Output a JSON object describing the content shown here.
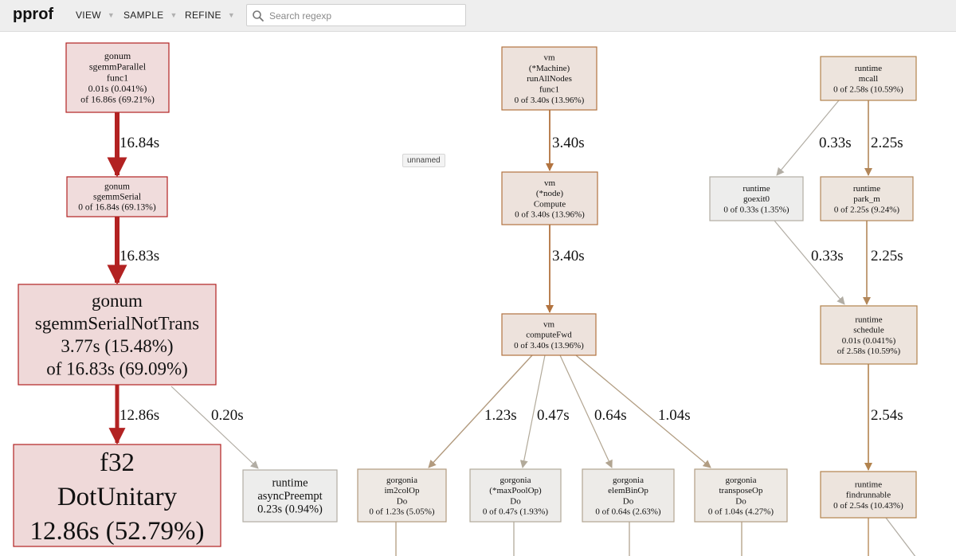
{
  "app": {
    "title": "pprof"
  },
  "menus": [
    {
      "label": "VIEW"
    },
    {
      "label": "SAMPLE"
    },
    {
      "label": "REFINE"
    }
  ],
  "search": {
    "placeholder": "Search regexp",
    "value": "",
    "icon": "search-icon"
  },
  "graph": {
    "legend_label": "unnamed",
    "nodes": [
      {
        "id": "sgemmParallel",
        "lines": [
          "gonum",
          "sgemmParallel",
          "func1",
          "0.01s (0.041%)",
          "of 16.86s (69.21%)"
        ],
        "fill": "#f0dcdc",
        "stroke": "#b22222"
      },
      {
        "id": "sgemmSerial",
        "lines": [
          "gonum",
          "sgemmSerial",
          "0 of 16.84s (69.13%)"
        ],
        "fill": "#f0dcdc",
        "stroke": "#b22222"
      },
      {
        "id": "sgemmSerialNotTrans",
        "lines": [
          "gonum",
          "sgemmSerialNotTrans",
          "3.77s (15.48%)",
          "of 16.83s (69.09%)"
        ],
        "fill": "#efd9d9",
        "stroke": "#b22222"
      },
      {
        "id": "f32DotUnitary",
        "lines": [
          "f32",
          "DotUnitary",
          "12.86s (52.79%)"
        ],
        "fill": "#efd9d9",
        "stroke": "#b22222"
      },
      {
        "id": "asyncPreempt",
        "lines": [
          "runtime",
          "asyncPreempt",
          "0.23s (0.94%)"
        ],
        "fill": "#ededec",
        "stroke": "#b2ada4"
      },
      {
        "id": "runAllNodes",
        "lines": [
          "vm",
          "(*Machine)",
          "runAllNodes",
          "func1",
          "0 of 3.40s (13.96%)"
        ],
        "fill": "#ede2dc",
        "stroke": "#b2733f"
      },
      {
        "id": "nodeCompute",
        "lines": [
          "vm",
          "(*node)",
          "Compute",
          "0 of 3.40s (13.96%)"
        ],
        "fill": "#ede2dc",
        "stroke": "#b2733f"
      },
      {
        "id": "computeFwd",
        "lines": [
          "vm",
          "computeFwd",
          "0 of 3.40s (13.96%)"
        ],
        "fill": "#ede2dc",
        "stroke": "#b2733f"
      },
      {
        "id": "im2colOp",
        "lines": [
          "gorgonia",
          "im2colOp",
          "Do",
          "0 of 1.23s (5.05%)"
        ],
        "fill": "#eee9e4",
        "stroke": "#b29a7e"
      },
      {
        "id": "maxPoolOp",
        "lines": [
          "gorgonia",
          "(*maxPoolOp)",
          "Do",
          "0 of 0.47s (1.93%)"
        ],
        "fill": "#edecea",
        "stroke": "#b2aa9a"
      },
      {
        "id": "elemBinOp",
        "lines": [
          "gorgonia",
          "elemBinOp",
          "Do",
          "0 of 0.64s (2.63%)"
        ],
        "fill": "#edebe8",
        "stroke": "#b2a591"
      },
      {
        "id": "transposeOp",
        "lines": [
          "gorgonia",
          "transposeOp",
          "Do",
          "0 of 1.04s (4.27%)"
        ],
        "fill": "#eeeae5",
        "stroke": "#b29d82"
      },
      {
        "id": "mcall",
        "lines": [
          "runtime",
          "mcall",
          "0 of 2.58s (10.59%)"
        ],
        "fill": "#ede4dd",
        "stroke": "#b2834e"
      },
      {
        "id": "goexit0",
        "lines": [
          "runtime",
          "goexit0",
          "0 of 0.33s (1.35%)"
        ],
        "fill": "#ededec",
        "stroke": "#b2ada4"
      },
      {
        "id": "park_m",
        "lines": [
          "runtime",
          "park_m",
          "0 of 2.25s (9.24%)"
        ],
        "fill": "#ede5de",
        "stroke": "#b2875a"
      },
      {
        "id": "schedule",
        "lines": [
          "runtime",
          "schedule",
          "0.01s (0.041%)",
          "of 2.58s (10.59%)"
        ],
        "fill": "#ede4dd",
        "stroke": "#b2834e"
      },
      {
        "id": "findrunnable",
        "lines": [
          "runtime",
          "findrunnable",
          "0 of 2.54s (10.43%)"
        ],
        "fill": "#ede4dd",
        "stroke": "#b2834e"
      }
    ],
    "edges": [
      {
        "from": "sgemmParallel",
        "to": "sgemmSerial",
        "label": "16.84s",
        "color": "#b22222"
      },
      {
        "from": "sgemmSerial",
        "to": "sgemmSerialNotTrans",
        "label": "16.83s",
        "color": "#b22222"
      },
      {
        "from": "sgemmSerialNotTrans",
        "to": "f32DotUnitary",
        "label": "12.86s",
        "color": "#b22222"
      },
      {
        "from": "sgemmSerialNotTrans",
        "to": "asyncPreempt",
        "label": "0.20s",
        "color": "#b2ada4"
      },
      {
        "from": "runAllNodes",
        "to": "nodeCompute",
        "label": "3.40s",
        "color": "#b2733f"
      },
      {
        "from": "nodeCompute",
        "to": "computeFwd",
        "label": "3.40s",
        "color": "#b2733f"
      },
      {
        "from": "computeFwd",
        "to": "im2colOp",
        "label": "1.23s",
        "color": "#b29a7e"
      },
      {
        "from": "computeFwd",
        "to": "maxPoolOp",
        "label": "0.47s",
        "color": "#b2aa9a"
      },
      {
        "from": "computeFwd",
        "to": "elemBinOp",
        "label": "0.64s",
        "color": "#b2a591"
      },
      {
        "from": "computeFwd",
        "to": "transposeOp",
        "label": "1.04s",
        "color": "#b29d82"
      },
      {
        "from": "mcall",
        "to": "goexit0",
        "label": "0.33s",
        "color": "#b2ada4"
      },
      {
        "from": "mcall",
        "to": "park_m",
        "label": "2.25s",
        "color": "#b2875a"
      },
      {
        "from": "goexit0",
        "to": "schedule",
        "label": "0.33s",
        "color": "#b2ada4"
      },
      {
        "from": "park_m",
        "to": "schedule",
        "label": "2.25s",
        "color": "#b2875a"
      },
      {
        "from": "schedule",
        "to": "findrunnable",
        "label": "2.54s",
        "color": "#b2834e"
      }
    ]
  }
}
